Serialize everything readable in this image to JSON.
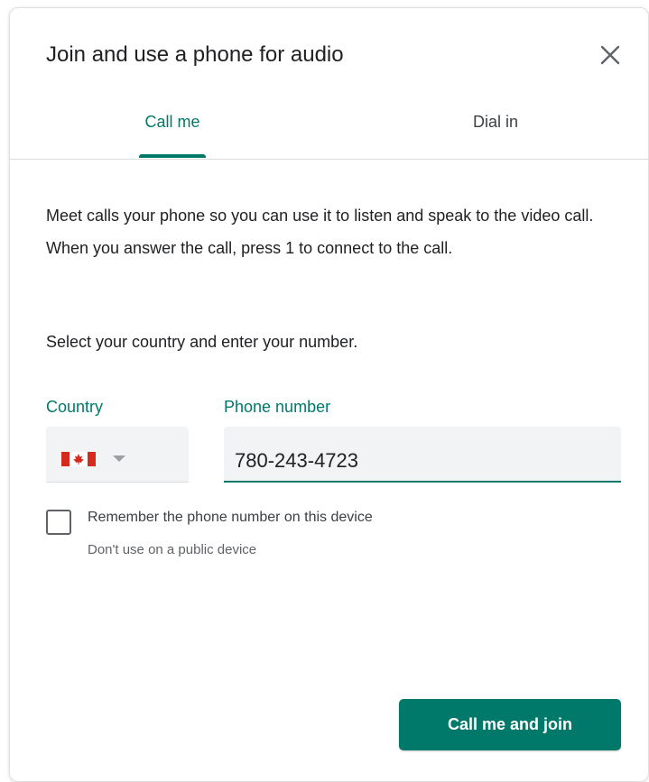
{
  "dialog": {
    "title": "Join and use a phone for audio",
    "close_icon": "close-icon"
  },
  "tabs": [
    {
      "label": "Call me",
      "selected": true
    },
    {
      "label": "Dial in",
      "selected": false
    }
  ],
  "description": "Meet calls your phone so you can use it to listen and speak to the video call. When you answer the call, press 1 to connect to the call.",
  "instruction": "Select your country and enter your number.",
  "country": {
    "label": "Country",
    "flag_icon": "canada-flag-icon",
    "dropdown_icon": "dropdown-arrow-icon"
  },
  "phone": {
    "label": "Phone number",
    "value": "780-243-4723"
  },
  "remember": {
    "label": "Remember the phone number on this device",
    "hint": "Don't use on a public device",
    "checked": false
  },
  "join_button": {
    "label": "Call me and join"
  },
  "colors": {
    "accent": "#00796b",
    "flag_red": "#d52b1e",
    "field_bg": "#f1f3f4"
  }
}
